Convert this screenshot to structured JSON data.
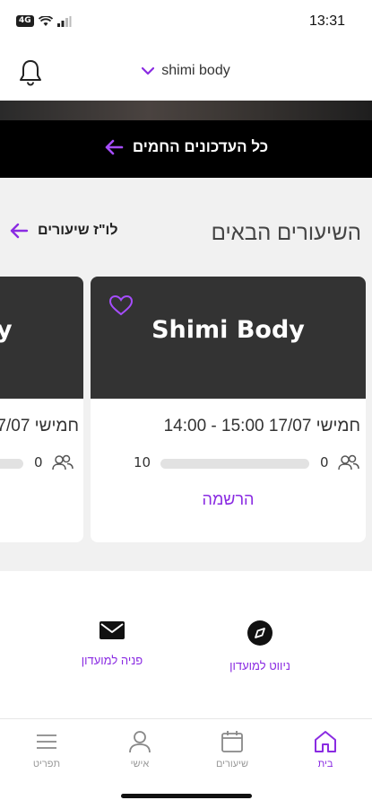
{
  "status": {
    "time": "13:31",
    "network": "4G"
  },
  "header": {
    "club_name": "shimi body"
  },
  "updates": {
    "label": "כל העדכונים החמים"
  },
  "classes": {
    "title": "השיעורים הבאים",
    "schedule_link": "לו\"ז שיעורים",
    "cards": [
      {
        "name": "Shimi Body",
        "date": "חמישי 17/07 15:00 - 14:00",
        "booked": "0",
        "capacity": "10",
        "action": "הרשמה"
      },
      {
        "name": "y",
        "date": "חמישי 17/07",
        "booked": "0"
      }
    ]
  },
  "actions": [
    {
      "label": "ניווט למועדון"
    },
    {
      "label": "פניה למועדון"
    }
  ],
  "nav": [
    {
      "label": "בית"
    },
    {
      "label": "שיעורים"
    },
    {
      "label": "אישי"
    },
    {
      "label": "תפריט"
    }
  ],
  "colors": {
    "accent": "#8a2be2",
    "dark": "#333333",
    "background": "#f1f1f1"
  }
}
